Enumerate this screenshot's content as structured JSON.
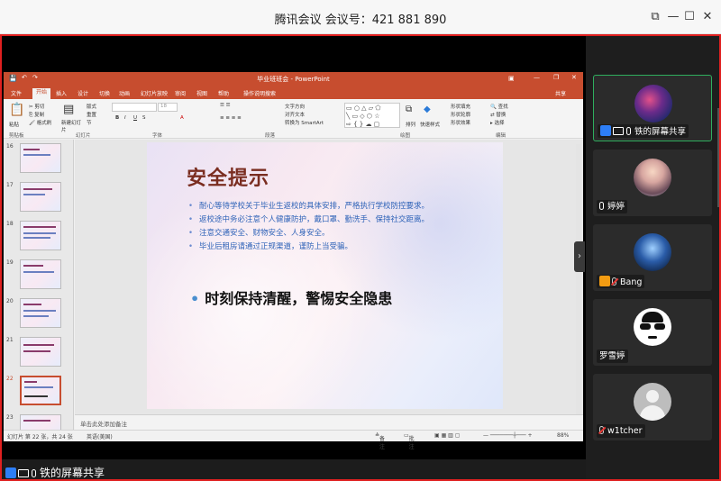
{
  "app": {
    "title": "腾讯会议 会议号：421 881 890",
    "window_controls": [
      "☐",
      "—",
      "☐",
      "✕"
    ]
  },
  "ppt": {
    "window_title": "毕业班班会 - PowerPoint",
    "share_label": "共享",
    "tabs": [
      "文件",
      "开始",
      "插入",
      "设计",
      "切换",
      "动画",
      "幻灯片放映",
      "审阅",
      "视图",
      "帮助",
      "操作说明搜索"
    ],
    "active_tab": "开始",
    "ribbon": {
      "clipboard": {
        "group": "剪贴板",
        "paste": "粘贴",
        "cut": "剪切",
        "copy": "复制",
        "format_painter": "格式刷"
      },
      "slides": {
        "group": "幻灯片",
        "new_slide": "新建幻灯片",
        "layout": "版式",
        "reset": "重置",
        "section": "节"
      },
      "font": {
        "group": "字体",
        "size": "18"
      },
      "paragraph": {
        "group": "段落",
        "text_direction": "文字方向",
        "align_text": "对齐文本",
        "smartart": "转换为 SmartArt"
      },
      "drawing": {
        "group": "绘图",
        "arrange": "排列",
        "quick_styles": "快速样式",
        "shape_fill": "形状填充",
        "shape_outline": "形状轮廓",
        "shape_effects": "形状效果"
      },
      "editing": {
        "group": "编辑",
        "find": "查找",
        "replace": "替换",
        "select": "选择"
      }
    },
    "thumbnails": [
      {
        "num": "16"
      },
      {
        "num": "17"
      },
      {
        "num": "18"
      },
      {
        "num": "19"
      },
      {
        "num": "20"
      },
      {
        "num": "21"
      },
      {
        "num": "22",
        "selected": true
      },
      {
        "num": "23"
      }
    ],
    "slide": {
      "title": "安全提示",
      "bullets": [
        "耐心等待学校关于毕业生返校的具体安排，严格执行学校防控要求。",
        "返校途中务必注意个人健康防护，戴口罩、勤洗手、保持社交距离。",
        "注意交通安全、财物安全、人身安全。",
        "毕业后租房请通过正规渠道，谨防上当受骗。"
      ],
      "highlight": "时刻保持清醒，警惕安全隐患"
    },
    "notes_placeholder": "单击此处添加备注",
    "status": {
      "slide_count": "幻灯片 第 22 张，共 24 张",
      "language": "英语(美国)",
      "notes": "备注",
      "comments": "批注",
      "zoom": "88%"
    }
  },
  "sharing_label": "铁的屏幕共享",
  "participants": [
    {
      "name": "铁的屏幕共享",
      "active": true,
      "avatar": "nebula"
    },
    {
      "name": "婷婷",
      "active": false,
      "avatar": "anime"
    },
    {
      "name": "Bang",
      "active": false,
      "avatar": "guitar"
    },
    {
      "name": "罗雪婷",
      "active": false,
      "avatar": "sunglasses"
    },
    {
      "name": "w1tcher",
      "active": false,
      "avatar": "default"
    }
  ]
}
